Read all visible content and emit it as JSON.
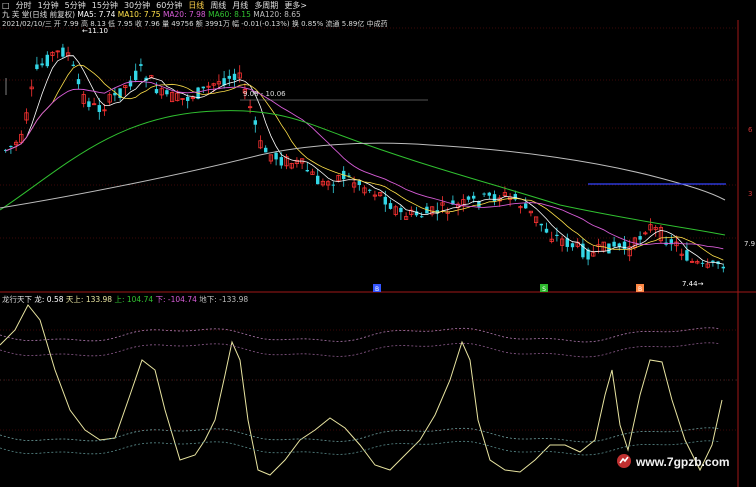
{
  "colors": {
    "up": "#ff3333",
    "down": "#33d6e6",
    "ma5": "#ffffff",
    "ma10": "#ffe14a",
    "ma20": "#d65cd6",
    "ma60": "#30c030",
    "ma120": "#bdbdbd",
    "indicator": "#e8e4a0",
    "dashed": "#b07ab0",
    "grid": "#7a1010",
    "blueline": "#3344ff"
  },
  "toolbar": {
    "icon": "□",
    "items": [
      "分时",
      "1分钟",
      "5分钟",
      "15分钟",
      "30分钟",
      "60分钟",
      "日线",
      "周线",
      "月线",
      "多周期",
      "更多>"
    ]
  },
  "ma_bar": {
    "name": "九 芙 堂(日线 前复权)",
    "ma5": "MA5: 7.74",
    "ma10": "MA10: 7.75",
    "ma20": "MA20: 7.98",
    "ma60": "MA60: 8.15",
    "ma120": "MA120: 8.65"
  },
  "detail_bar": {
    "text": "2021/02/10/三 开 7.99 高 8.13 低 7.95 收 7.96 量 49756 额 3991万 幅 -0.01(-0.13%) 换 0.85% 流通 5.89亿 中成药"
  },
  "indicator_bar": {
    "name": "龙行天下",
    "long": "龙: 0.58",
    "tianshang": "天上: 133.98",
    "shang": "上: 104.74",
    "xia": "下: -104.74",
    "dixia": "地下: -133.98"
  },
  "annotations": {
    "high": "11.10",
    "range": "9.08 - 10.06",
    "low": "7.44",
    "right_price": "7.9",
    "right_a": "6",
    "right_b": "3",
    "sig1": "B",
    "sig2": "S",
    "sig3": "B"
  },
  "watermark": "www.7gpzb.com"
}
